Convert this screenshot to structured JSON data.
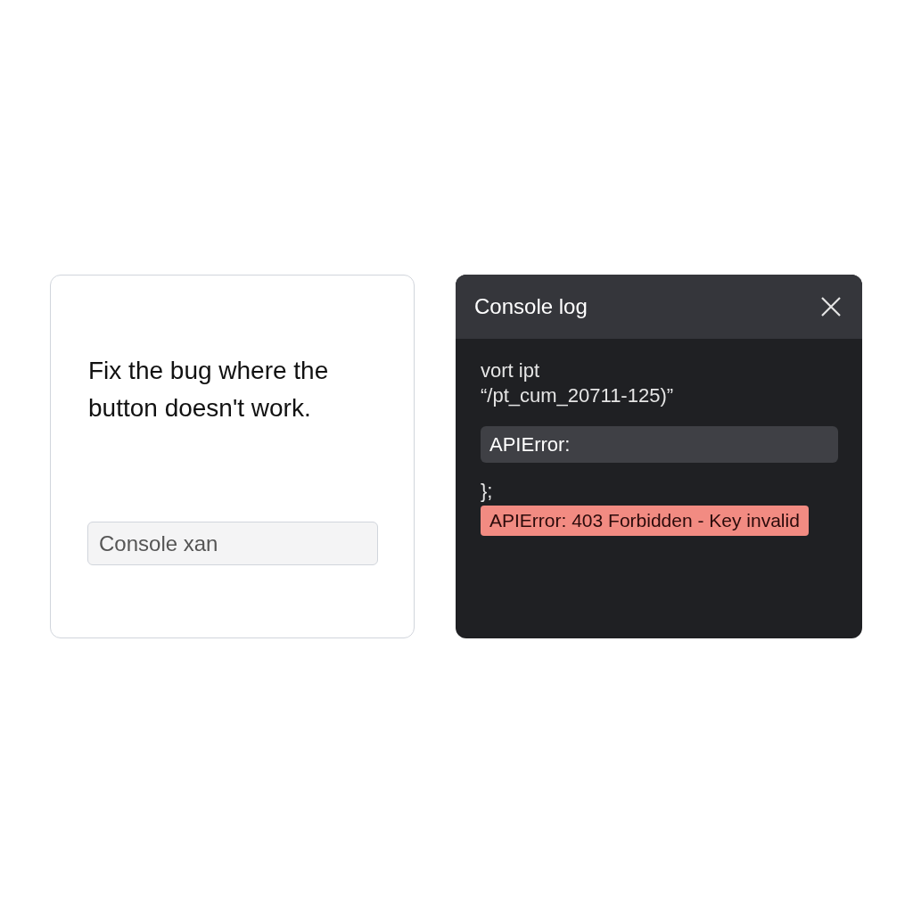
{
  "prompt_card": {
    "message": "Fix the bug where the button doesn't work.",
    "input": {
      "value": "Console xan"
    }
  },
  "console": {
    "title": "Console log",
    "lines": [
      {
        "kind": "plain",
        "text": "vort ipt"
      },
      {
        "kind": "plain",
        "text": "“/pt_cum_20711-125)”"
      },
      {
        "kind": "highlight",
        "text": "APIError:"
      },
      {
        "kind": "plain",
        "text": "};"
      },
      {
        "kind": "error",
        "text": "APIError: 403 Forbidden - Key invalid"
      }
    ]
  }
}
